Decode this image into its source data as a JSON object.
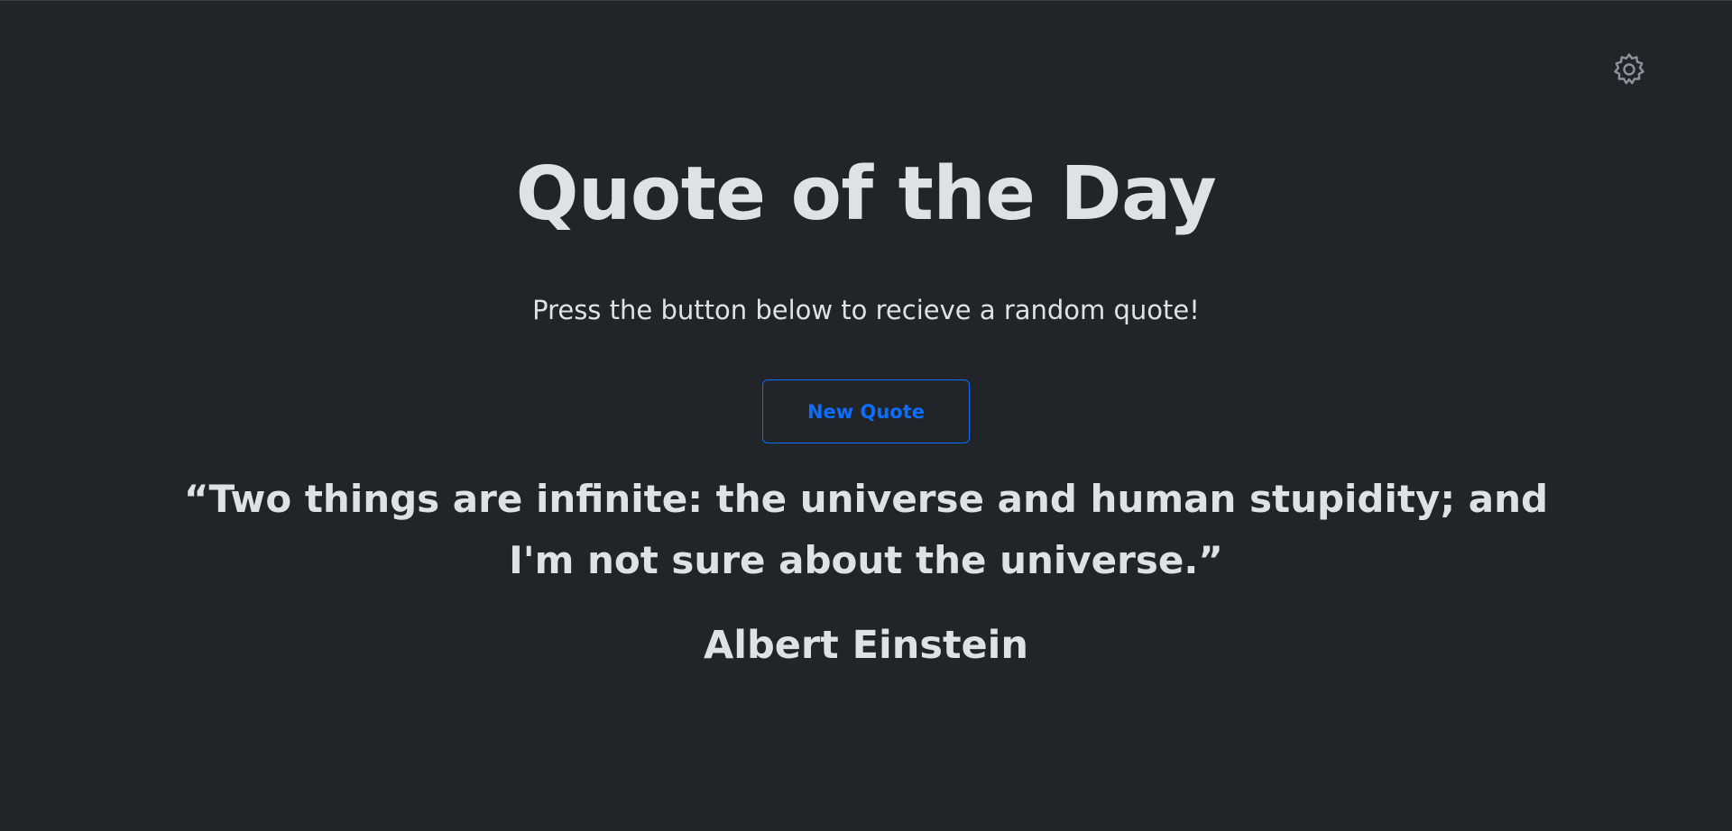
{
  "header": {
    "settings_icon": "gear-icon"
  },
  "main": {
    "title": "Quote of the Day",
    "subtitle": "Press the button below to recieve a random quote!",
    "new_quote_label": "New Quote",
    "quote": {
      "text": "“Two things are infinite: the universe and human stupidity; and I'm not sure about the universe.”",
      "author": "Albert Einstein"
    }
  },
  "colors": {
    "background": "#212529",
    "text": "#dee2e6",
    "accent": "#0d6efd",
    "icon": "#8c939a"
  }
}
